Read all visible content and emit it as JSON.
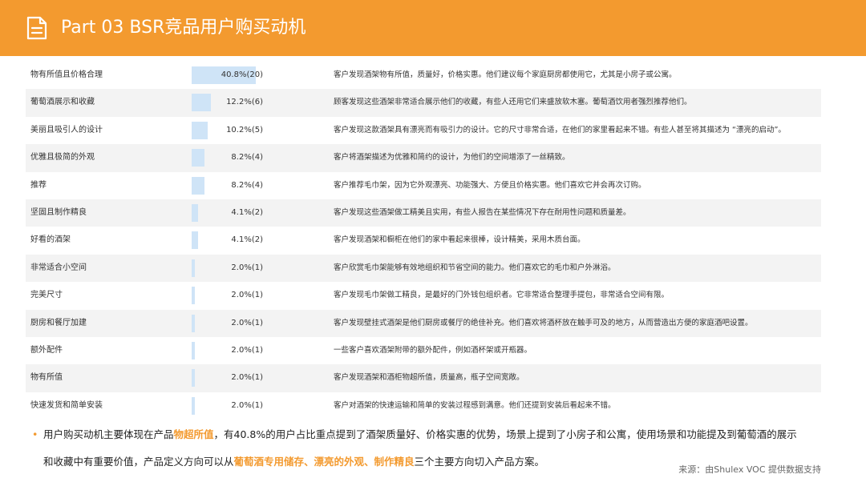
{
  "header": {
    "title": "Part 03  BSR竞品用户购买动机",
    "icon": "document-icon",
    "color": "#f39a2f"
  },
  "table": {
    "bar_color": "#cfe4f7",
    "rows": [
      {
        "name": "物有所值且价格合理",
        "pct": "40.8%(20)",
        "share": 0.408,
        "desc": "客户发现酒架物有所值，质量好，价格实惠。他们建议每个家庭厨房都使用它，尤其是小房子或公寓。"
      },
      {
        "name": "葡萄酒展示和收藏",
        "pct": "12.2%(6)",
        "share": 0.122,
        "desc": "顾客发现这些酒架非常适合展示他们的收藏，有些人还用它们来盛放软木塞。葡萄酒饮用者强烈推荐他们。"
      },
      {
        "name": "美丽且吸引人的设计",
        "pct": "10.2%(5)",
        "share": 0.102,
        "desc": "客户发现这款酒架具有漂亮而有吸引力的设计。它的尺寸非常合适，在他们的家里看起来不错。有些人甚至将其描述为 “漂亮的启动”。"
      },
      {
        "name": "优雅且极简的外观",
        "pct": "8.2%(4)",
        "share": 0.082,
        "desc": "客户将酒架描述为优雅和简约的设计，为他们的空间增添了一丝精致。"
      },
      {
        "name": "推荐",
        "pct": "8.2%(4)",
        "share": 0.082,
        "desc": "客户推荐毛巾架，因为它外观漂亮、功能强大、方便且价格实惠。他们喜欢它并会再次订购。"
      },
      {
        "name": "坚固且制作精良",
        "pct": "4.1%(2)",
        "share": 0.041,
        "desc": "客户发现这些酒架做工精美且实用，有些人报告在某些情况下存在耐用性问题和质量差。"
      },
      {
        "name": "好看的酒架",
        "pct": "4.1%(2)",
        "share": 0.041,
        "desc": "客户发现酒架和橱柜在他们的家中看起来很棒，设计精美，采用木质台面。"
      },
      {
        "name": "非常适合小空间",
        "pct": "2.0%(1)",
        "share": 0.02,
        "desc": "客户欣赏毛巾架能够有效地组织和节省空间的能力。他们喜欢它的毛巾和户外淋浴。"
      },
      {
        "name": "完美尺寸",
        "pct": "2.0%(1)",
        "share": 0.02,
        "desc": "客户发现毛巾架做工精良，是最好的门外钱包组织者。它非常适合整理手提包，非常适合空间有限。"
      },
      {
        "name": "厨房和餐厅加建",
        "pct": "2.0%(1)",
        "share": 0.02,
        "desc": "客户发现壁挂式酒架是他们厨房或餐厅的绝佳补充。他们喜欢将酒杯放在触手可及的地方，从而营造出方便的家庭酒吧设置。"
      },
      {
        "name": "额外配件",
        "pct": "2.0%(1)",
        "share": 0.02,
        "desc": "一些客户喜欢酒架附带的额外配件，例如酒杯架或开瓶器。"
      },
      {
        "name": "物有所值",
        "pct": "2.0%(1)",
        "share": 0.02,
        "desc": "客户发现酒架和酒柜物超所值，质量高，瓶子空间宽敞。"
      },
      {
        "name": "快速发货和简单安装",
        "pct": "2.0%(1)",
        "share": 0.02,
        "desc": "客户对酒架的快速运输和简单的安装过程感到满意。他们还提到安装后看起来不错。"
      }
    ]
  },
  "summary": {
    "line1_a": "用户购买动机主要体现在产品",
    "line1_hl": "物超所值",
    "line1_b": "，有40.8%的用户占比重点提到了酒架质量好、价格实惠的优势，场景上提到了小房子和公寓，使用场景和功能提及到葡萄酒的展示",
    "line2_a": "和收藏中有重要价值，产品定义方向可以从",
    "line2_hl": "葡萄酒专用储存、漂亮的外观、制作精良",
    "line2_b": "三个主要方向切入产品方案。",
    "accent_color": "#f39a2f"
  },
  "source": "来源：由Shulex VOC 提供数据支持"
}
